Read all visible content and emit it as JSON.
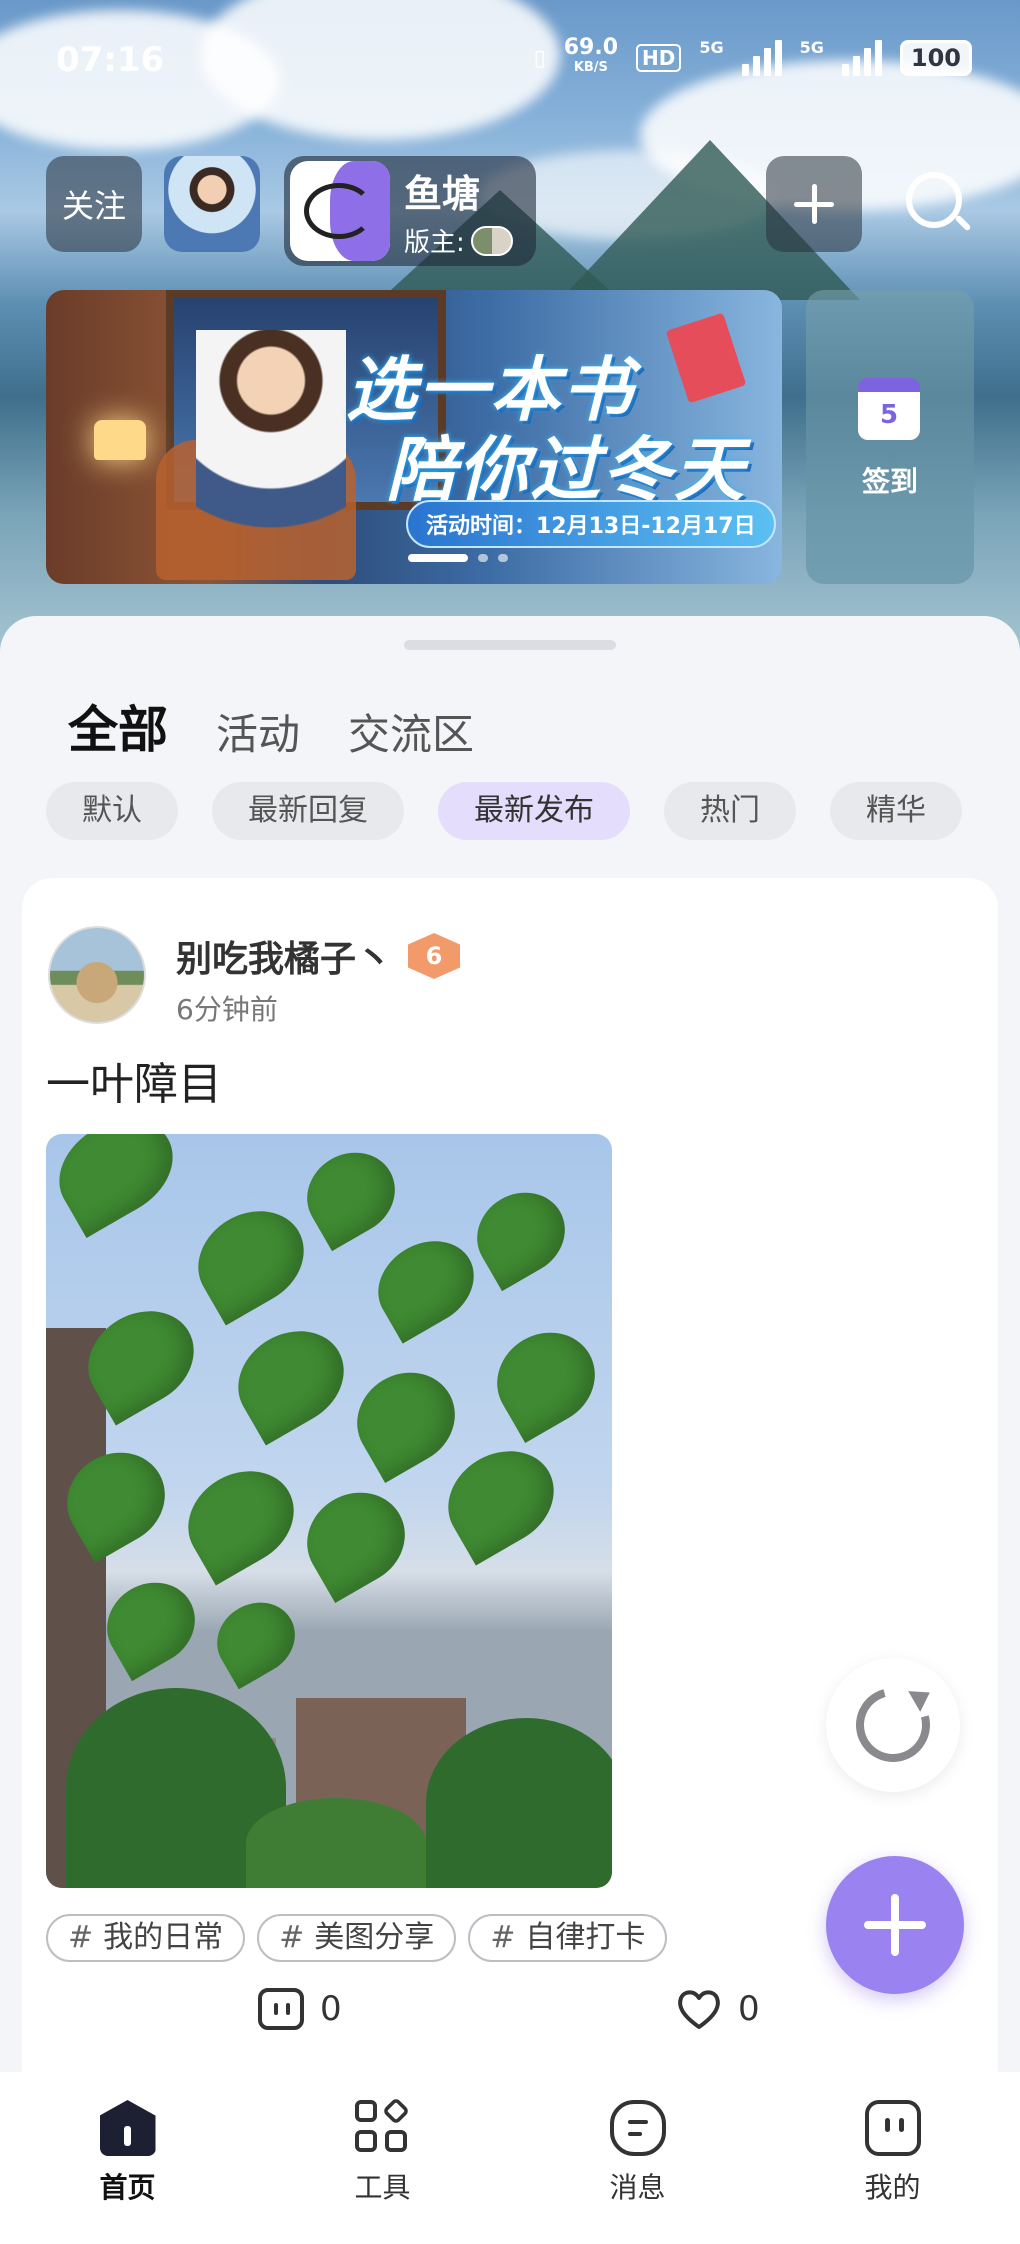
{
  "status_bar": {
    "time": "07:16",
    "net_speed": "69.0",
    "net_unit": "KB/S",
    "hd": "HD",
    "signal1_label": "5G",
    "signal2_label": "5G",
    "battery": "100"
  },
  "header": {
    "follow_label": "关注",
    "circle_name": "鱼塘",
    "owner_label": "版主:",
    "add_icon": "plus-icon",
    "search_icon": "search-icon"
  },
  "banner": {
    "title_line1": "选一本书",
    "title_line2": "陪你过冬天",
    "date_text": "活动时间：12月13日-12月17日",
    "active_dot": 1,
    "dot_count": 3
  },
  "checkin": {
    "calendar_day": "5",
    "label": "签到"
  },
  "tabs": [
    {
      "label": "全部",
      "active": true
    },
    {
      "label": "活动",
      "active": false
    },
    {
      "label": "交流区",
      "active": false
    }
  ],
  "filters": [
    {
      "label": "默认",
      "active": false
    },
    {
      "label": "最新回复",
      "active": false
    },
    {
      "label": "最新发布",
      "active": true
    },
    {
      "label": "热门",
      "active": false
    },
    {
      "label": "精华",
      "active": false
    }
  ],
  "post": {
    "username": "别吃我橘子丶",
    "level": "6",
    "time": "6分钟前",
    "title": "一叶障目",
    "tags": [
      "我的日常",
      "美图分享",
      "自律打卡"
    ],
    "tag_prefix": "#",
    "comment_count": "0",
    "like_count": "0"
  },
  "bottom_nav": [
    {
      "label": "首页",
      "icon": "home-icon",
      "active": true
    },
    {
      "label": "工具",
      "icon": "tools-icon",
      "active": false
    },
    {
      "label": "消息",
      "icon": "message-icon",
      "active": false
    },
    {
      "label": "我的",
      "icon": "profile-icon",
      "active": false
    }
  ],
  "colors": {
    "accent": "#9a82f0",
    "tab_highlight": "#8b72ea",
    "chip_active_bg": "#e4ddfb"
  }
}
